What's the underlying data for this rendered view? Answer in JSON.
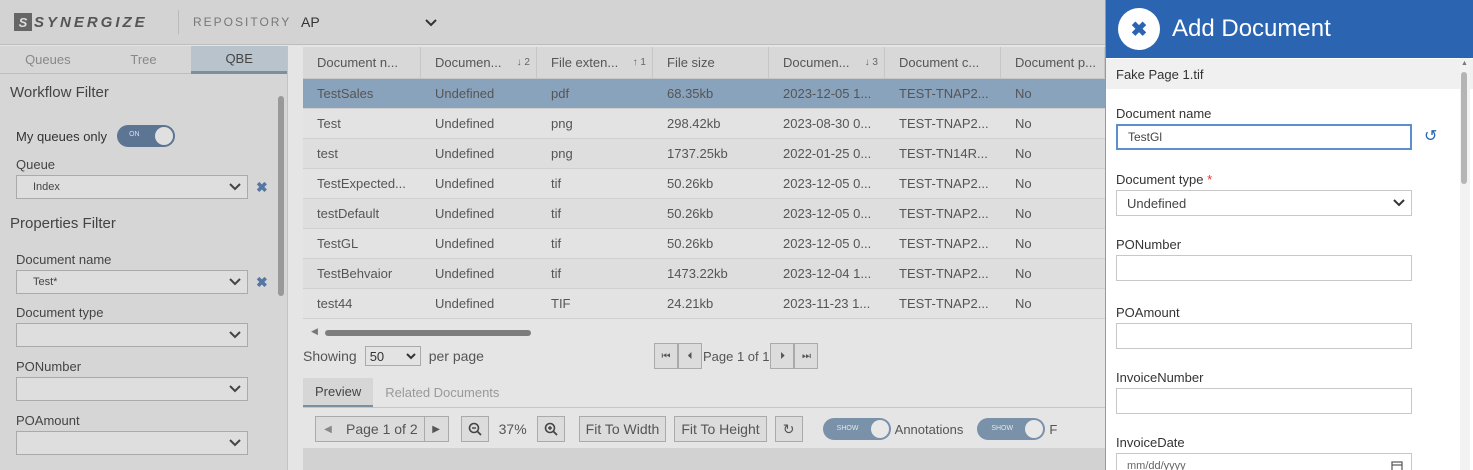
{
  "app": {
    "logo_letter": "S",
    "logo_text": "SYNERGIZE",
    "repository_label": "REPOSITORY",
    "repository_value": "AP"
  },
  "left": {
    "tabs": [
      "Queues",
      "Tree",
      "QBE"
    ],
    "workflow_filter": "Workflow Filter",
    "my_queues_only": "My queues only",
    "toggle_on": "ON",
    "queue_label": "Queue",
    "queue_value": "Index",
    "properties_filter": "Properties Filter",
    "doc_name_label": "Document name",
    "doc_name_value": "Test*",
    "doc_type_label": "Document type",
    "ponumber_label": "PONumber",
    "poamount_label": "POAmount"
  },
  "grid": {
    "headers": [
      "Document n...",
      "Documen...",
      "File exten...",
      "File size",
      "Documen...",
      "Document c...",
      "Document p..."
    ],
    "sort_marks": [
      "",
      "↓ 2",
      "↑ 1",
      "",
      "↓ 3",
      "",
      ""
    ],
    "rows": [
      [
        "TestSales",
        "Undefined",
        "pdf",
        "68.35kb",
        "2023-12-05 1...",
        "TEST-TNAP2...",
        "No"
      ],
      [
        "Test",
        "Undefined",
        "png",
        "298.42kb",
        "2023-08-30 0...",
        "TEST-TNAP2...",
        "No"
      ],
      [
        "test",
        "Undefined",
        "png",
        "1737.25kb",
        "2022-01-25 0...",
        "TEST-TN14R...",
        "No"
      ],
      [
        "TestExpected...",
        "Undefined",
        "tif",
        "50.26kb",
        "2023-12-05 0...",
        "TEST-TNAP2...",
        "No"
      ],
      [
        "testDefault",
        "Undefined",
        "tif",
        "50.26kb",
        "2023-12-05 0...",
        "TEST-TNAP2...",
        "No"
      ],
      [
        "TestGL",
        "Undefined",
        "tif",
        "50.26kb",
        "2023-12-05 0...",
        "TEST-TNAP2...",
        "No"
      ],
      [
        "TestBehvaior",
        "Undefined",
        "tif",
        "1473.22kb",
        "2023-12-04 1...",
        "TEST-TNAP2...",
        "No"
      ],
      [
        "test44",
        "Undefined",
        "TIF",
        "24.21kb",
        "2023-11-23 1...",
        "TEST-TNAP2...",
        "No"
      ]
    ]
  },
  "pager": {
    "showing": "Showing",
    "per_page_value": "50",
    "per_page": "per page",
    "page_text": "Page 1 of 1"
  },
  "preview": {
    "tabs": [
      "Preview",
      "Related Documents"
    ],
    "page_text": "Page 1 of 2",
    "zoom": "37%",
    "fit_width": "Fit To Width",
    "fit_height": "Fit To Height",
    "show": "SHOW",
    "annotations": "Annotations",
    "cut_label": "F"
  },
  "drawer": {
    "title": "Add Document",
    "filename": "Fake Page 1.tif",
    "doc_name_label": "Document name",
    "doc_name_value": "TestGl",
    "doc_type_label": "Document type",
    "required_mark": "*",
    "doc_type_value": "Undefined",
    "ponumber_label": "PONumber",
    "poamount_label": "POAmount",
    "invoicenumber_label": "InvoiceNumber",
    "invoicedate_label": "InvoiceDate",
    "invoicedate_placeholder": "mm/dd/yyyy"
  },
  "colors": {
    "accent": "#2b65b1",
    "selected_row": "#8aa3bd"
  }
}
